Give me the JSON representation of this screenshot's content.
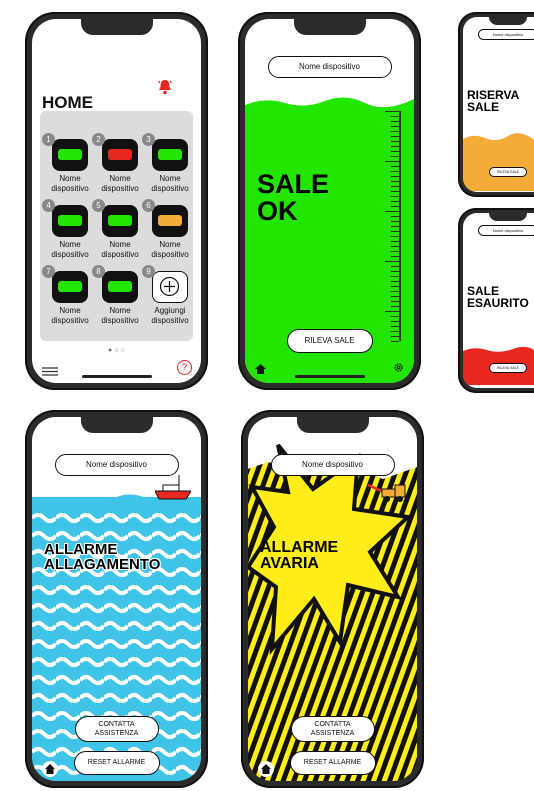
{
  "colors": {
    "ok": "#22e600",
    "reserve": "#f4ac38",
    "empty": "#e8281f",
    "flood": "#3fc3e6",
    "fault": "#ffed1a",
    "alert": "#e8281f"
  },
  "home": {
    "title": "HOME",
    "alert_icon": "bell-icon",
    "devices": [
      {
        "num": "1",
        "label": "Nome dispositivo",
        "status": "ok"
      },
      {
        "num": "2",
        "label": "Nome dispositivo",
        "status": "empty"
      },
      {
        "num": "3",
        "label": "Nome dispositivo",
        "status": "ok"
      },
      {
        "num": "4",
        "label": "Nome dispositivo",
        "status": "ok"
      },
      {
        "num": "5",
        "label": "Nome dispositivo",
        "status": "ok"
      },
      {
        "num": "6",
        "label": "Nome dispositivo",
        "status": "reserve"
      },
      {
        "num": "7",
        "label": "Nome dispositivo",
        "status": "ok"
      },
      {
        "num": "8",
        "label": "Nome dispositivo",
        "status": "ok"
      }
    ],
    "add": {
      "num": "9",
      "label": "Aggiungi dispositivo"
    },
    "menu_icon": "hamburger-icon",
    "help_icon": "question-icon"
  },
  "sale_ok": {
    "device_name": "Nome dispositivo",
    "title_line1": "SALE",
    "title_line2": "OK",
    "button": "RILEVA SALE",
    "level": 0.85
  },
  "riserva": {
    "device_name": "Nome dispositivo",
    "title_line1": "RISERVA",
    "title_line2": "SALE",
    "button": "RILEVA SALE",
    "level": 0.25
  },
  "esaurito": {
    "device_name": "Nome dispositivo",
    "title_line1": "SALE",
    "title_line2": "ESAURITO",
    "button": "RILEVA SALE",
    "level": 0.12
  },
  "allagamento": {
    "device_name": "Nome dispositivo",
    "title_line1": "ALLARME",
    "title_line2": "ALLAGAMENTO",
    "contact": "CONTATTA ASSISTENZA",
    "reset": "RESET ALLARME"
  },
  "avaria": {
    "device_name": "Nome dispositivo",
    "title_line1": "ALLARME",
    "title_line2": "AVARIA",
    "contact": "CONTATTA ASSISTENZA",
    "reset": "RESET ALLARME"
  }
}
